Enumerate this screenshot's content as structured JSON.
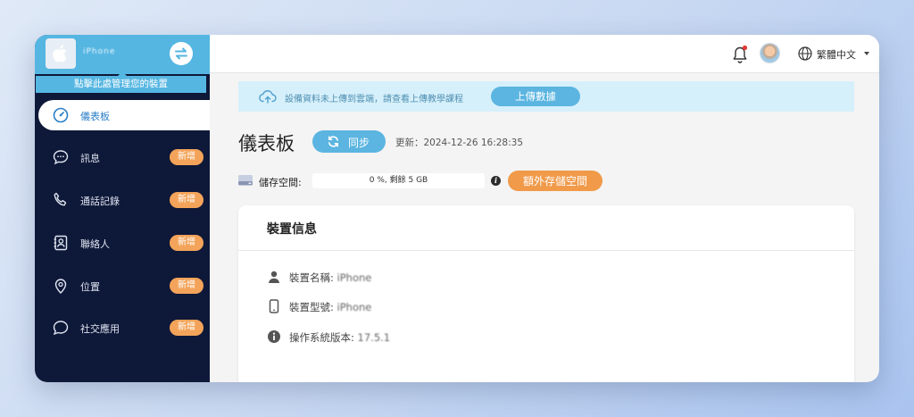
{
  "sidebar": {
    "device_name": "iPhone",
    "manage_tip": "點擊此處管理您的裝置",
    "items": [
      {
        "label": "儀表板",
        "icon": "dashboard-gauge-icon",
        "active": true
      },
      {
        "label": "訊息",
        "icon": "chat-bubble-icon",
        "badge": "新增"
      },
      {
        "label": "通話記錄",
        "icon": "phone-icon",
        "badge": "新增"
      },
      {
        "label": "聯絡人",
        "icon": "contact-book-icon",
        "badge": "新增"
      },
      {
        "label": "位置",
        "icon": "location-pin-icon",
        "badge": "新增"
      },
      {
        "label": "社交應用",
        "icon": "speech-bubble-icon",
        "badge": "新增"
      }
    ]
  },
  "topbar": {
    "language": "繁體中文"
  },
  "banner": {
    "text": "設備資料未上傳到雲端，請查看上傳教學課程",
    "button": "上傳數據"
  },
  "dashboard": {
    "title": "儀表板",
    "sync_button": "同步",
    "updated": "更新：2024-12-26 16:28:35",
    "storage_label": "儲存空間:",
    "storage_value": "0 %, 剩餘 5 GB",
    "extra_storage_button": "額外存儲空間"
  },
  "device_info": {
    "title": "裝置信息",
    "rows": [
      {
        "label": "裝置名稱:",
        "value": "iPhone",
        "icon": "person-icon"
      },
      {
        "label": "裝置型號:",
        "value": "iPhone",
        "icon": "mobile-phone-icon"
      },
      {
        "label": "操作系統版本:",
        "value": "17.5.1",
        "icon": "info-circle-icon"
      }
    ]
  },
  "colors": {
    "sidebar_bg": "#0e1838",
    "accent_blue": "#5bb5e0",
    "badge_orange": "#f3a45a",
    "banner_bg": "#d6f0fb"
  }
}
